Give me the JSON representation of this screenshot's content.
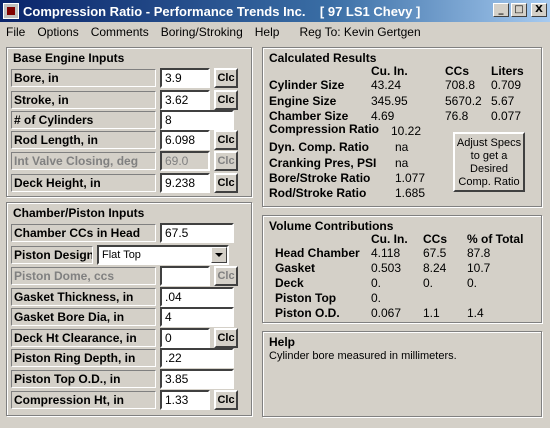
{
  "window": {
    "title": "Compression Ratio - Performance Trends Inc.    [ 97 LS1 Chevy ]",
    "minimize": "_",
    "maximize": "□",
    "close": "X"
  },
  "menu": {
    "items": [
      "File",
      "Options",
      "Comments",
      "Boring/Stroking",
      "Help"
    ],
    "reg": "Reg To: Kevin Gertgen"
  },
  "base_inputs": {
    "title": "Base Engine Inputs",
    "clc_label": "Clc",
    "rows": [
      {
        "label": "Bore, in",
        "value": "3.9"
      },
      {
        "label": "Stroke, in",
        "value": "3.62"
      },
      {
        "label": "# of Cylinders",
        "value": "8"
      },
      {
        "label": "Rod Length, in",
        "value": "6.098"
      },
      {
        "label": "Int Valve Closing, deg",
        "value": "69.0"
      },
      {
        "label": "Deck Height, in",
        "value": "9.238"
      }
    ]
  },
  "chamber_inputs": {
    "title": "Chamber/Piston Inputs",
    "clc_label": "Clc",
    "rows": [
      {
        "label": "Chamber CCs in Head",
        "value": "67.5"
      },
      {
        "label": "Piston Design",
        "value": "Flat Top"
      },
      {
        "label": "Piston Dome, ccs",
        "value": ""
      },
      {
        "label": "Gasket Thickness, in",
        "value": ".04"
      },
      {
        "label": "Gasket Bore Dia, in",
        "value": "4"
      },
      {
        "label": "Deck Ht Clearance, in",
        "value": "0"
      },
      {
        "label": "Piston Ring Depth, in",
        "value": ".22"
      },
      {
        "label": "Piston Top O.D., in",
        "value": "3.85"
      },
      {
        "label": "Compression Ht, in",
        "value": "1.33"
      }
    ]
  },
  "results": {
    "title": "Calculated Results",
    "col_cuin": "Cu. In.",
    "col_ccs": "CCs",
    "col_liters": "Liters",
    "rows": [
      {
        "label": "Cylinder Size",
        "cuin": "43.24",
        "ccs": "708.8",
        "liters": "0.709"
      },
      {
        "label": "Engine Size",
        "cuin": "345.95",
        "ccs": "5670.2",
        "liters": "5.67"
      },
      {
        "label": "Chamber Size",
        "cuin": "4.69",
        "ccs": "76.8",
        "liters": "0.077"
      }
    ],
    "compression_ratio_label": "Compression Ratio",
    "compression_ratio_value": "10.22",
    "dyn_label": "Dyn. Comp. Ratio",
    "dyn_value": "na",
    "cranking_label": "Cranking Pres, PSI",
    "cranking_value": "na",
    "bs_label": "Bore/Stroke Ratio",
    "bs_value": "1.077",
    "rs_label": "Rod/Stroke Ratio",
    "rs_value": "1.685",
    "adjust_button": "Adjust Specs to get a Desired Comp. Ratio"
  },
  "volume": {
    "title": "Volume Contributions",
    "col_cuin": "Cu. In.",
    "col_ccs": "CCs",
    "col_pct": "% of Total",
    "rows": [
      {
        "label": "Head Chamber",
        "cuin": "4.118",
        "ccs": "67.5",
        "pct": "87.8"
      },
      {
        "label": "Gasket",
        "cuin": "0.503",
        "ccs": "8.24",
        "pct": "10.7"
      },
      {
        "label": "Deck",
        "cuin": "0.",
        "ccs": "0.",
        "pct": "0."
      },
      {
        "label": "Piston Top",
        "cuin": "0.",
        "ccs": "",
        "pct": ""
      },
      {
        "label": "Piston O.D.",
        "cuin": "0.067",
        "ccs": "1.1",
        "pct": "1.4"
      }
    ]
  },
  "help": {
    "title": "Help",
    "text": "Cylinder bore measured in millimeters."
  }
}
